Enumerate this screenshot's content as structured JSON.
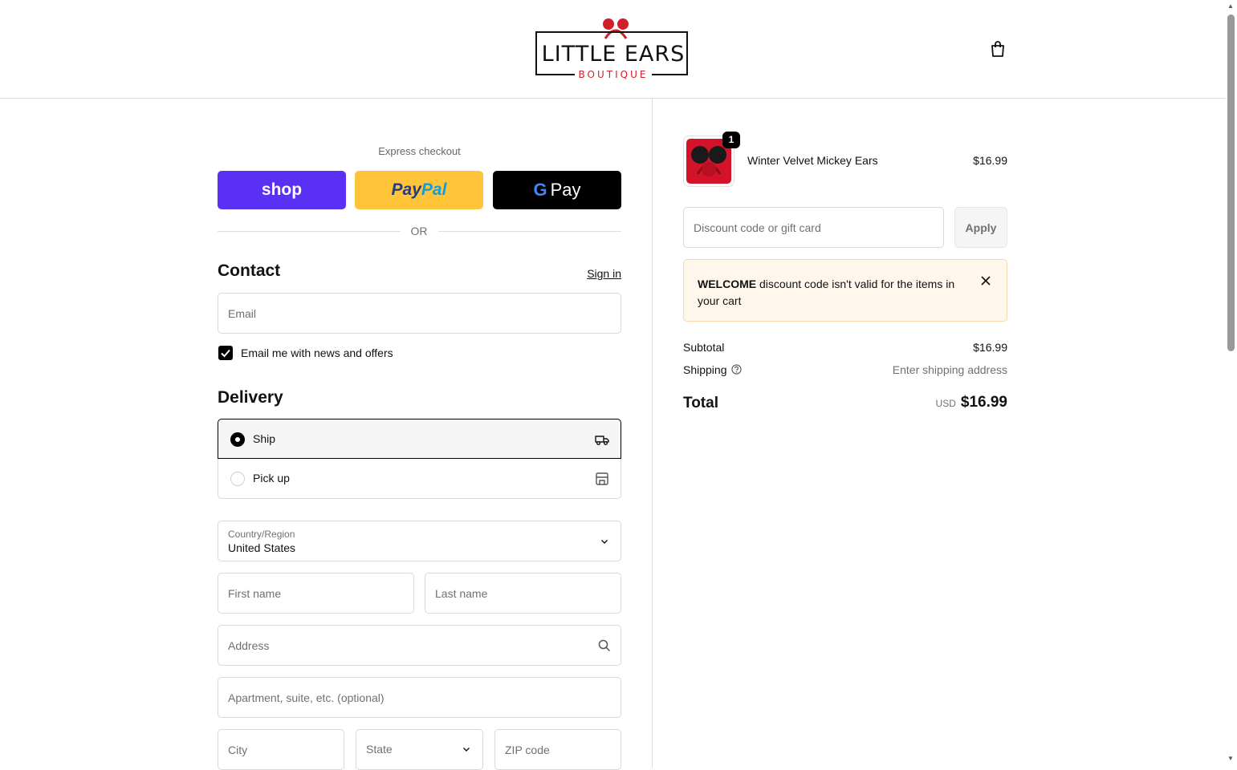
{
  "header": {
    "logo": {
      "title": "LITTLE  EARS",
      "subtitle": "BOUTIQUE"
    },
    "cart_icon": "shopping-bag-icon"
  },
  "express": {
    "label": "Express checkout",
    "shop_label": "shop",
    "paypal_label_a": "Pay",
    "paypal_label_b": "Pal",
    "gpay_g": "G",
    "gpay_label": "Pay",
    "or_label": "OR"
  },
  "contact": {
    "title": "Contact",
    "sign_in": "Sign in",
    "email_placeholder": "Email",
    "newsletter_label": "Email me with news and offers",
    "newsletter_checked": true
  },
  "delivery": {
    "title": "Delivery",
    "options": [
      {
        "label": "Ship",
        "selected": true,
        "icon": "truck-icon"
      },
      {
        "label": "Pick up",
        "selected": false,
        "icon": "store-icon"
      }
    ],
    "country_label": "Country/Region",
    "country_value": "United States",
    "first_name_placeholder": "First name",
    "last_name_placeholder": "Last name",
    "address_placeholder": "Address",
    "apartment_placeholder": "Apartment, suite, etc. (optional)",
    "city_placeholder": "City",
    "state_placeholder": "State",
    "zip_placeholder": "ZIP code"
  },
  "summary": {
    "item": {
      "name": "Winter Velvet Mickey Ears",
      "price": "$16.99",
      "quantity": "1"
    },
    "discount_placeholder": "Discount code or gift card",
    "apply_label": "Apply",
    "alert": {
      "code": "WELCOME",
      "message": " discount code isn't valid for the items in your cart"
    },
    "subtotal_label": "Subtotal",
    "subtotal_value": "$16.99",
    "shipping_label": "Shipping",
    "shipping_value": "Enter shipping address",
    "total_label": "Total",
    "currency": "USD",
    "total_value": "$16.99"
  },
  "colors": {
    "shop_pay": "#5a31f4",
    "paypal": "#ffc439",
    "gpay": "#000000",
    "alert_bg": "#fff7ec",
    "brand_red": "#d0202a"
  }
}
